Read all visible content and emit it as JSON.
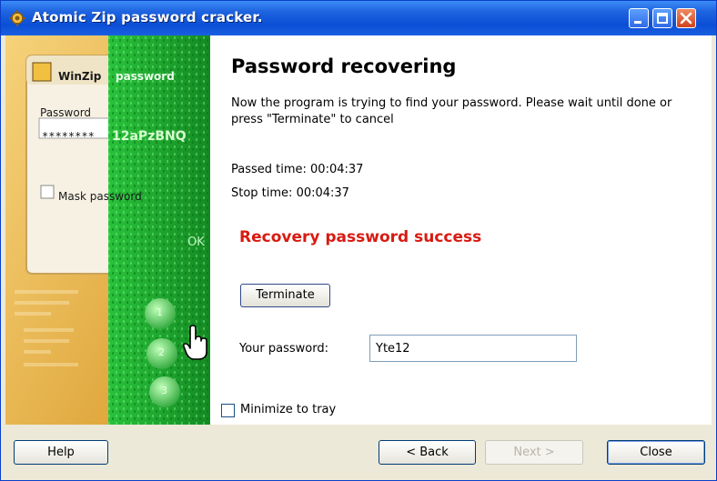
{
  "window": {
    "title": "Atomic Zip password cracker.",
    "app_icon": "gear-icon",
    "controls": [
      "minimize-icon",
      "maximize-icon",
      "close-icon"
    ]
  },
  "sidepanel": {
    "winzip_title": "WinZip",
    "password_label": "Password",
    "masked_value": "********",
    "overlay_password_label": "password",
    "cracked_fragment": "12aPzBNQ",
    "mask_label": "Mask password",
    "ok_label": "OK",
    "step_numbers": [
      "1",
      "2",
      "3"
    ],
    "cursor_icon": "hand-cursor-icon"
  },
  "main": {
    "heading": "Password recovering",
    "description": "Now the program is trying to find your password. Please wait until done or press \"Terminate\" to cancel",
    "passed_time": "Passed time: 00:04:37",
    "stop_time": "Stop time: 00:04:37",
    "status": "Recovery password success",
    "status_color": "#d81b12",
    "terminate_label": "Terminate",
    "password_label": "Your password:",
    "password_value": "Yte12",
    "minimize_label": "Minimize to tray",
    "minimize_checked": false
  },
  "footer": {
    "help_label": "Help",
    "back_label": "< Back",
    "next_label": "Next >",
    "close_label": "Close"
  },
  "colors": {
    "titlebar": "#0a4fd6",
    "panel_green": "#1fae2f",
    "panel_gold": "#e8b54a"
  }
}
